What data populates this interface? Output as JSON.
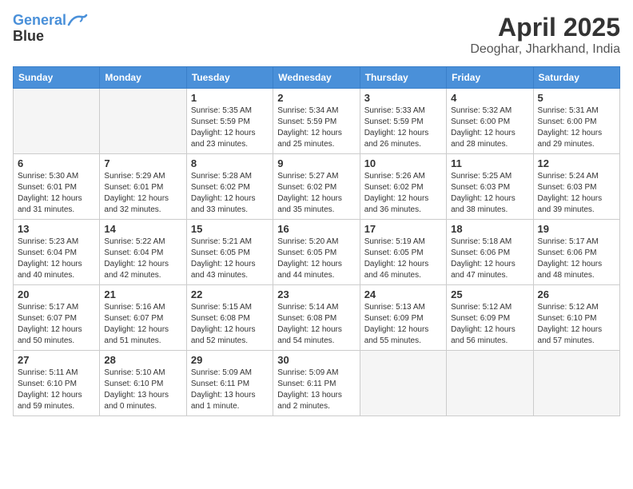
{
  "header": {
    "logo_line1": "General",
    "logo_line2": "Blue",
    "title": "April 2025",
    "subtitle": "Deoghar, Jharkhand, India"
  },
  "weekdays": [
    "Sunday",
    "Monday",
    "Tuesday",
    "Wednesday",
    "Thursday",
    "Friday",
    "Saturday"
  ],
  "weeks": [
    [
      {
        "day": "",
        "empty": true
      },
      {
        "day": "",
        "empty": true
      },
      {
        "day": "1",
        "sunrise": "5:35 AM",
        "sunset": "5:59 PM",
        "daylight": "12 hours and 23 minutes."
      },
      {
        "day": "2",
        "sunrise": "5:34 AM",
        "sunset": "5:59 PM",
        "daylight": "12 hours and 25 minutes."
      },
      {
        "day": "3",
        "sunrise": "5:33 AM",
        "sunset": "5:59 PM",
        "daylight": "12 hours and 26 minutes."
      },
      {
        "day": "4",
        "sunrise": "5:32 AM",
        "sunset": "6:00 PM",
        "daylight": "12 hours and 28 minutes."
      },
      {
        "day": "5",
        "sunrise": "5:31 AM",
        "sunset": "6:00 PM",
        "daylight": "12 hours and 29 minutes."
      }
    ],
    [
      {
        "day": "6",
        "sunrise": "5:30 AM",
        "sunset": "6:01 PM",
        "daylight": "12 hours and 31 minutes."
      },
      {
        "day": "7",
        "sunrise": "5:29 AM",
        "sunset": "6:01 PM",
        "daylight": "12 hours and 32 minutes."
      },
      {
        "day": "8",
        "sunrise": "5:28 AM",
        "sunset": "6:02 PM",
        "daylight": "12 hours and 33 minutes."
      },
      {
        "day": "9",
        "sunrise": "5:27 AM",
        "sunset": "6:02 PM",
        "daylight": "12 hours and 35 minutes."
      },
      {
        "day": "10",
        "sunrise": "5:26 AM",
        "sunset": "6:02 PM",
        "daylight": "12 hours and 36 minutes."
      },
      {
        "day": "11",
        "sunrise": "5:25 AM",
        "sunset": "6:03 PM",
        "daylight": "12 hours and 38 minutes."
      },
      {
        "day": "12",
        "sunrise": "5:24 AM",
        "sunset": "6:03 PM",
        "daylight": "12 hours and 39 minutes."
      }
    ],
    [
      {
        "day": "13",
        "sunrise": "5:23 AM",
        "sunset": "6:04 PM",
        "daylight": "12 hours and 40 minutes."
      },
      {
        "day": "14",
        "sunrise": "5:22 AM",
        "sunset": "6:04 PM",
        "daylight": "12 hours and 42 minutes."
      },
      {
        "day": "15",
        "sunrise": "5:21 AM",
        "sunset": "6:05 PM",
        "daylight": "12 hours and 43 minutes."
      },
      {
        "day": "16",
        "sunrise": "5:20 AM",
        "sunset": "6:05 PM",
        "daylight": "12 hours and 44 minutes."
      },
      {
        "day": "17",
        "sunrise": "5:19 AM",
        "sunset": "6:05 PM",
        "daylight": "12 hours and 46 minutes."
      },
      {
        "day": "18",
        "sunrise": "5:18 AM",
        "sunset": "6:06 PM",
        "daylight": "12 hours and 47 minutes."
      },
      {
        "day": "19",
        "sunrise": "5:17 AM",
        "sunset": "6:06 PM",
        "daylight": "12 hours and 48 minutes."
      }
    ],
    [
      {
        "day": "20",
        "sunrise": "5:17 AM",
        "sunset": "6:07 PM",
        "daylight": "12 hours and 50 minutes."
      },
      {
        "day": "21",
        "sunrise": "5:16 AM",
        "sunset": "6:07 PM",
        "daylight": "12 hours and 51 minutes."
      },
      {
        "day": "22",
        "sunrise": "5:15 AM",
        "sunset": "6:08 PM",
        "daylight": "12 hours and 52 minutes."
      },
      {
        "day": "23",
        "sunrise": "5:14 AM",
        "sunset": "6:08 PM",
        "daylight": "12 hours and 54 minutes."
      },
      {
        "day": "24",
        "sunrise": "5:13 AM",
        "sunset": "6:09 PM",
        "daylight": "12 hours and 55 minutes."
      },
      {
        "day": "25",
        "sunrise": "5:12 AM",
        "sunset": "6:09 PM",
        "daylight": "12 hours and 56 minutes."
      },
      {
        "day": "26",
        "sunrise": "5:12 AM",
        "sunset": "6:10 PM",
        "daylight": "12 hours and 57 minutes."
      }
    ],
    [
      {
        "day": "27",
        "sunrise": "5:11 AM",
        "sunset": "6:10 PM",
        "daylight": "12 hours and 59 minutes."
      },
      {
        "day": "28",
        "sunrise": "5:10 AM",
        "sunset": "6:10 PM",
        "daylight": "13 hours and 0 minutes."
      },
      {
        "day": "29",
        "sunrise": "5:09 AM",
        "sunset": "6:11 PM",
        "daylight": "13 hours and 1 minute."
      },
      {
        "day": "30",
        "sunrise": "5:09 AM",
        "sunset": "6:11 PM",
        "daylight": "13 hours and 2 minutes."
      },
      {
        "day": "",
        "empty": true
      },
      {
        "day": "",
        "empty": true
      },
      {
        "day": "",
        "empty": true
      }
    ]
  ]
}
